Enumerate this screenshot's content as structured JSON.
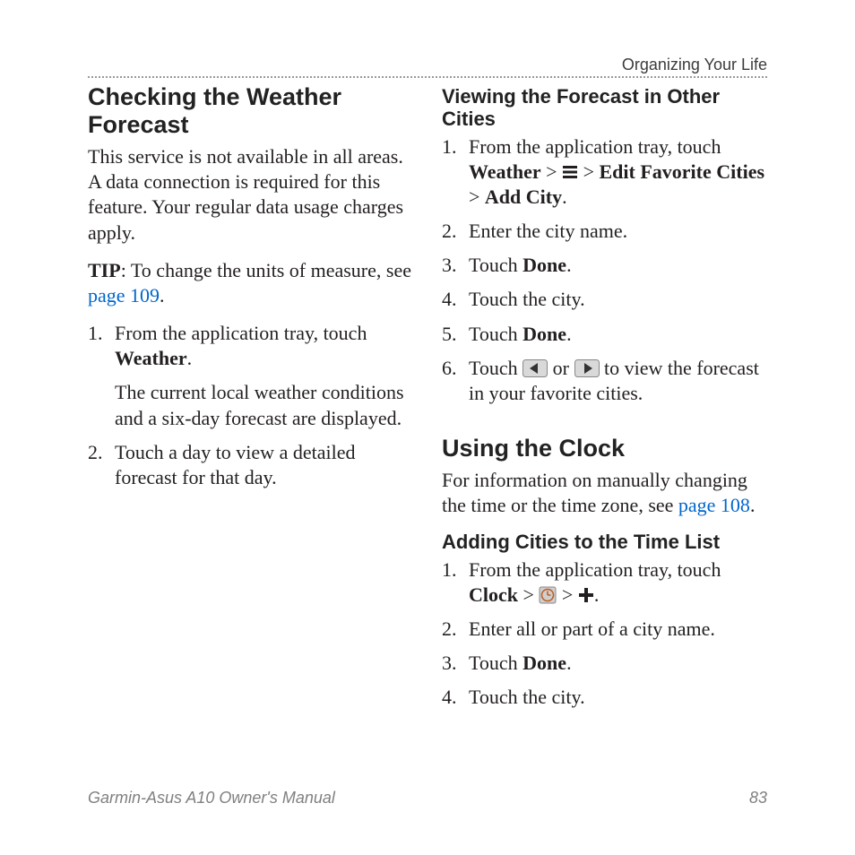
{
  "running_head": "Organizing Your Life",
  "left": {
    "h2": "Checking the Weather Forecast",
    "intro": "This service is not available in all areas. A data connection is required for this feature. Your regular data usage charges apply.",
    "tip_label": "TIP",
    "tip_text": ": To change the units of measure, see ",
    "tip_link": "page 109",
    "tip_after": ".",
    "step1_a": "From the application tray, touch ",
    "step1_b": "Weather",
    "step1_c": ".",
    "step1_sub": "The current local weather conditions and a six-day forecast are displayed.",
    "step2": "Touch a day to view a detailed forecast for that day."
  },
  "right": {
    "h3a": "Viewing the Forecast in Other Cities",
    "s1_a": "From the application tray, touch ",
    "s1_b": "Weather",
    "s1_c": " > ",
    "s1_d": " > ",
    "s1_e": "Edit Favorite Cities",
    "s1_f": " > ",
    "s1_g": "Add City",
    "s1_h": ".",
    "s2": "Enter the city name.",
    "s3_a": "Touch ",
    "s3_b": "Done",
    "s3_c": ".",
    "s4": "Touch the city.",
    "s5_a": "Touch ",
    "s5_b": "Done",
    "s5_c": ".",
    "s6_a": "Touch ",
    "s6_b": " or ",
    "s6_c": " to view the forecast in your favorite cities.",
    "h2b": "Using the Clock",
    "clock_intro_a": "For information on manually changing the time or the time zone, see ",
    "clock_intro_link": "page 108",
    "clock_intro_b": ".",
    "h3b": "Adding Cities to the Time List",
    "c1_a": "From the application tray, touch ",
    "c1_b": "Clock",
    "c1_c": " > ",
    "c1_d": " > ",
    "c1_e": ".",
    "c2": "Enter all or part of a city name.",
    "c3_a": "Touch ",
    "c3_b": "Done",
    "c3_c": ".",
    "c4": "Touch the city."
  },
  "footer": {
    "title": "Garmin-Asus A10 Owner's Manual",
    "page": "83"
  }
}
